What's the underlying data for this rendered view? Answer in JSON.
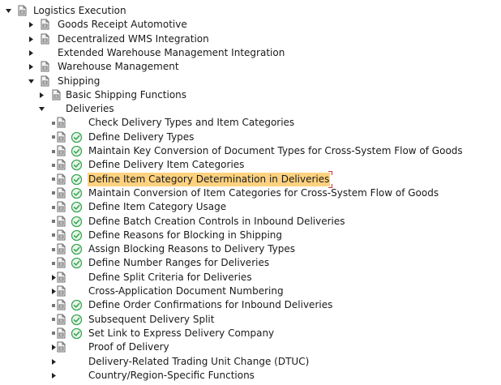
{
  "tree": {
    "rows": [
      {
        "label": "Logistics Execution",
        "level": 0,
        "toggle": "expanded",
        "doc": true,
        "activity": false,
        "selected": false
      },
      {
        "label": "Goods Receipt Automotive",
        "level": 1,
        "toggle": "collapsed",
        "doc": true,
        "activity": false,
        "selected": false
      },
      {
        "label": "Decentralized WMS Integration",
        "level": 1,
        "toggle": "collapsed",
        "doc": true,
        "activity": false,
        "selected": false
      },
      {
        "label": "Extended Warehouse Management Integration",
        "level": 1,
        "toggle": "collapsed",
        "doc": false,
        "activity": false,
        "selected": false
      },
      {
        "label": "Warehouse Management",
        "level": 1,
        "toggle": "collapsed",
        "doc": true,
        "activity": false,
        "selected": false
      },
      {
        "label": "Shipping",
        "level": 1,
        "toggle": "expanded",
        "doc": true,
        "activity": false,
        "selected": false
      },
      {
        "label": "Basic Shipping Functions",
        "level": 2,
        "toggle": "collapsed",
        "doc": true,
        "activity": false,
        "selected": false
      },
      {
        "label": "Deliveries",
        "level": 2,
        "toggle": "expanded",
        "doc": false,
        "activity": false,
        "selected": false
      },
      {
        "label": "Check Delivery Types and Item Categories",
        "level": 3,
        "toggle": "leaf",
        "doc": true,
        "activity": false,
        "selected": false
      },
      {
        "label": "Define Delivery Types",
        "level": 3,
        "toggle": "leaf",
        "doc": true,
        "activity": true,
        "selected": false
      },
      {
        "label": "Maintain Key Conversion of Document Types for Cross-System Flow of Goods",
        "level": 3,
        "toggle": "leaf",
        "doc": true,
        "activity": true,
        "selected": false
      },
      {
        "label": "Define Delivery Item Categories",
        "level": 3,
        "toggle": "leaf",
        "doc": true,
        "activity": true,
        "selected": false
      },
      {
        "label": "Define Item Category Determination in Deliveries",
        "level": 3,
        "toggle": "leaf",
        "doc": true,
        "activity": true,
        "selected": true
      },
      {
        "label": "Maintain Conversion of Item Categories for Cross-System Flow of Goods",
        "level": 3,
        "toggle": "leaf",
        "doc": true,
        "activity": true,
        "selected": false
      },
      {
        "label": "Define Item Category Usage",
        "level": 3,
        "toggle": "leaf",
        "doc": true,
        "activity": true,
        "selected": false
      },
      {
        "label": "Define Batch Creation Controls in Inbound Deliveries",
        "level": 3,
        "toggle": "leaf",
        "doc": true,
        "activity": true,
        "selected": false
      },
      {
        "label": "Define Reasons for Blocking in Shipping",
        "level": 3,
        "toggle": "leaf",
        "doc": true,
        "activity": true,
        "selected": false
      },
      {
        "label": "Assign Blocking Reasons to Delivery Types",
        "level": 3,
        "toggle": "leaf",
        "doc": true,
        "activity": true,
        "selected": false
      },
      {
        "label": "Define Number Ranges for Deliveries",
        "level": 3,
        "toggle": "leaf",
        "doc": true,
        "activity": true,
        "selected": false
      },
      {
        "label": "Define Split Criteria for Deliveries",
        "level": 3,
        "toggle": "collapsed",
        "doc": true,
        "activity": false,
        "selected": false
      },
      {
        "label": "Cross-Application Document Numbering",
        "level": 3,
        "toggle": "collapsed",
        "doc": true,
        "activity": false,
        "selected": false
      },
      {
        "label": "Define Order Confirmations for Inbound Deliveries",
        "level": 3,
        "toggle": "leaf",
        "doc": true,
        "activity": true,
        "selected": false
      },
      {
        "label": "Subsequent Delivery Split",
        "level": 3,
        "toggle": "leaf",
        "doc": true,
        "activity": true,
        "selected": false
      },
      {
        "label": "Set Link to Express Delivery Company",
        "level": 3,
        "toggle": "leaf",
        "doc": true,
        "activity": true,
        "selected": false
      },
      {
        "label": "Proof of Delivery",
        "level": 3,
        "toggle": "collapsed",
        "doc": true,
        "activity": false,
        "selected": false
      },
      {
        "label": "Delivery-Related Trading Unit Change (DTUC)",
        "level": 3,
        "toggle": "collapsed",
        "doc": false,
        "activity": false,
        "selected": false
      },
      {
        "label": "Country/Region-Specific Functions",
        "level": 3,
        "toggle": "collapsed",
        "doc": false,
        "activity": false,
        "selected": false
      }
    ]
  },
  "colors": {
    "text": "#1a1a1a",
    "selection_bg": "#ffd27f",
    "selection_marker": "#d32f2f",
    "toggle": "#222222",
    "doc_icon": "#6a6a6a",
    "activity_icon_green": "#3aa655"
  },
  "icons": {
    "expanded": "triangle-down-icon",
    "collapsed": "triangle-right-icon",
    "leaf": "bullet-square-icon",
    "doc": "document-icon",
    "activity": "execute-activity-icon"
  }
}
